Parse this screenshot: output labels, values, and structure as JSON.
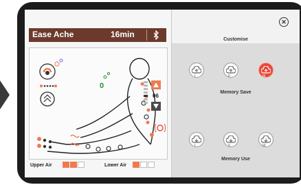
{
  "program_name": "Ease Ache",
  "time": "16min",
  "intensity_level": "06",
  "air": {
    "upper_label": "Upper Air",
    "lower_label": "Lower Air",
    "upper_level": 2,
    "lower_level": 1,
    "segments": 3
  },
  "customise": {
    "title": "Customise",
    "memory_save_label": "Memory Save",
    "memory_use_label": "Memory Use",
    "slots": [
      "I",
      "II",
      "III"
    ]
  },
  "colors": {
    "accent": "#f07a50",
    "header": "#6b3a2c",
    "active_slot": "#e8493a"
  }
}
